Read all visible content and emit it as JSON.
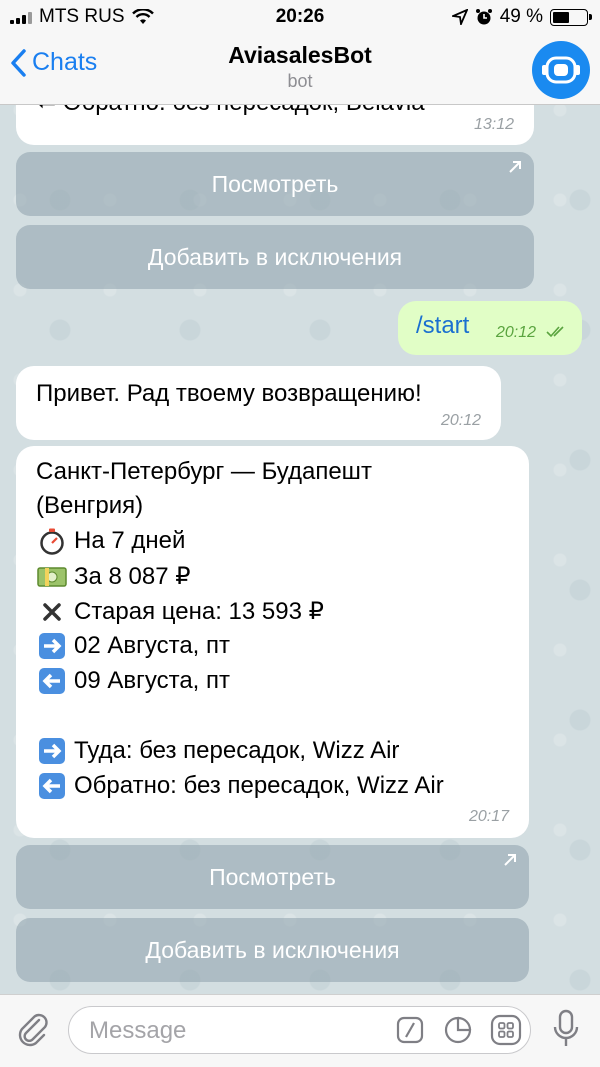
{
  "status_bar": {
    "carrier": "MTS RUS",
    "time": "20:26",
    "battery": "49 %",
    "battery_level": 0.49
  },
  "nav": {
    "back_label": "Chats",
    "title": "AviasalesBot",
    "subtitle": "bot"
  },
  "messages": {
    "prev_fragment": "⬅ Обратно: без пересадок, Belavia",
    "prev_time": "13:12",
    "prev_buttons": [
      "Посмотреть",
      "Добавить в исключения"
    ],
    "outgoing": {
      "text": "/start",
      "time": "20:12"
    },
    "greeting": {
      "text": "Привет. Рад твоему возвращению!",
      "time": "20:12"
    },
    "offer": {
      "route_line1": "Санкт-Петербург — Будапешт",
      "route_line2": "(Венгрия)",
      "duration": "На 7 дней",
      "price": "За 8 087 ₽",
      "old_price": "Старая цена: 13 593 ₽",
      "depart_date": "02 Августа, пт",
      "return_date": "09 Августа, пт",
      "there": "Туда: без пересадок, Wizz Air",
      "back": "Обратно: без пересадок, Wizz Air",
      "time": "20:17"
    },
    "offer_buttons": [
      "Посмотреть",
      "Добавить в исключения"
    ]
  },
  "input": {
    "placeholder": "Message"
  },
  "icons": {
    "attach": "paperclip-icon",
    "command": "slash-command-icon",
    "sticker": "sticker-icon",
    "bot_keyboard": "keyboard-grid-icon",
    "mic": "microphone-icon"
  },
  "colors": {
    "accent": "#1a7ff0",
    "outgoing_bubble": "#e1fec6",
    "button_bg": "#96a8b2"
  }
}
